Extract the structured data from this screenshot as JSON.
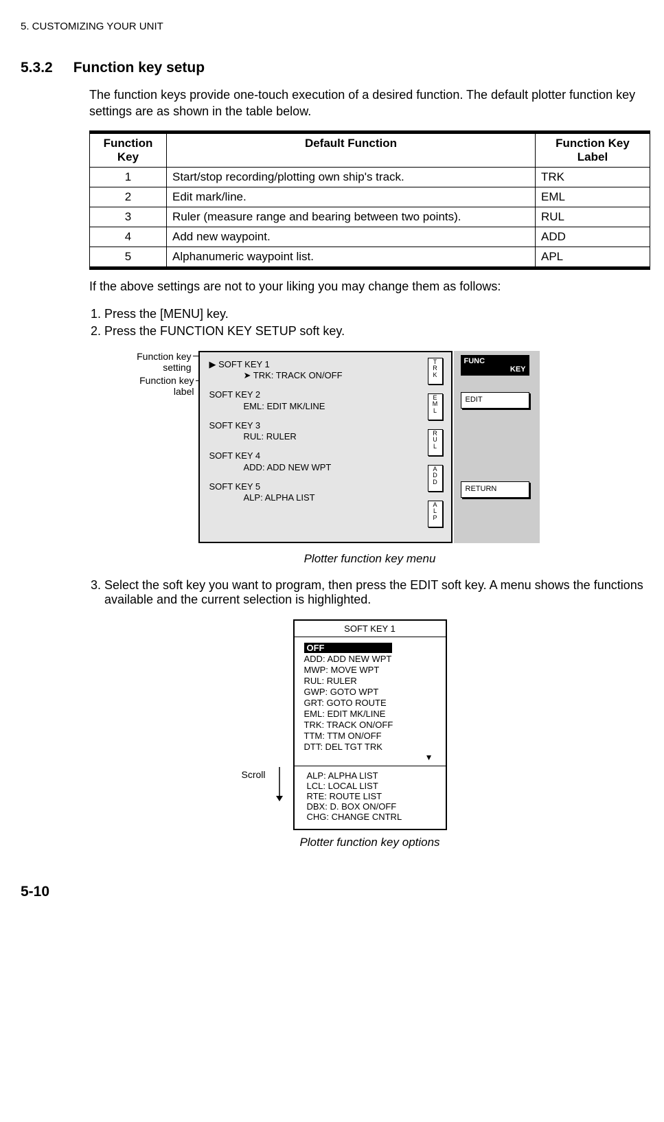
{
  "header": "5. CUSTOMIZING YOUR UNIT",
  "section_num": "5.3.2",
  "section_title": "Function key setup",
  "intro": "The function keys provide one-touch execution of a desired function. The default plotter function key settings are as shown in the table below.",
  "table": {
    "headers": [
      "Function Key",
      "Default Function",
      "Function Key Label"
    ],
    "rows": [
      [
        "1",
        "Start/stop recording/plotting own ship's track.",
        "TRK"
      ],
      [
        "2",
        "Edit mark/line.",
        "EML"
      ],
      [
        "3",
        "Ruler (measure range and bearing between two points).",
        "RUL"
      ],
      [
        "4",
        "Add new waypoint.",
        "ADD"
      ],
      [
        "5",
        "Alphanumeric waypoint list.",
        "APL"
      ]
    ]
  },
  "after_table": "If the above settings are not to your liking you may change them as follows:",
  "steps12": [
    "Press the [MENU] key.",
    "Press the FUNCTION KEY SETUP soft key."
  ],
  "fig1": {
    "annot1": "Function key setting",
    "annot2": "Function key label",
    "softkeys": [
      {
        "name": "SOFT KEY 1",
        "val": "TRK: TRACK ON/OFF",
        "tag": "TRK"
      },
      {
        "name": "SOFT KEY 2",
        "val": "EML: EDIT MK/LINE",
        "tag": "EML"
      },
      {
        "name": "SOFT KEY 3",
        "val": "RUL: RULER",
        "tag": "RUL"
      },
      {
        "name": "SOFT KEY 4",
        "val": "ADD: ADD NEW WPT",
        "tag": "ADD"
      },
      {
        "name": "SOFT KEY 5",
        "val": "ALP: ALPHA LIST",
        "tag": "ALP"
      }
    ],
    "funckey_line1": "FUNC",
    "funckey_line2": "KEY",
    "edit_btn": "EDIT",
    "return_btn": "RETURN",
    "caption": "Plotter function key menu"
  },
  "step3": "Select the soft key you want to program, then press the EDIT soft key. A menu shows the functions available and the current selection is highlighted.",
  "fig2": {
    "title": "SOFT KEY 1",
    "off": "OFF",
    "list1": [
      "ADD: ADD NEW WPT",
      "MWP: MOVE WPT",
      "RUL: RULER",
      "GWP: GOTO WPT",
      "GRT: GOTO ROUTE",
      "EML: EDIT MK/LINE",
      "TRK: TRACK ON/OFF",
      "TTM: TTM ON/OFF",
      "DTT: DEL TGT TRK"
    ],
    "list2": [
      "ALP: ALPHA LIST",
      "LCL: LOCAL LIST",
      "RTE: ROUTE LIST",
      "DBX: D. BOX ON/OFF",
      "CHG: CHANGE CNTRL"
    ],
    "scroll_label": "Scroll",
    "caption": "Plotter function key options"
  },
  "page_num": "5-10"
}
